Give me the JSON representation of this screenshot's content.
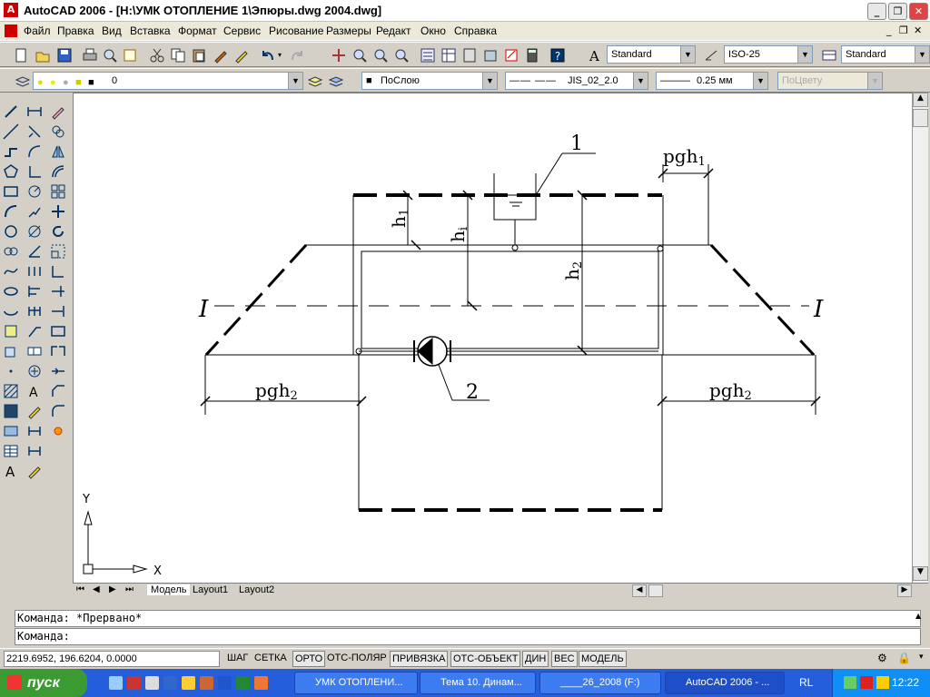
{
  "window": {
    "title": "AutoCAD 2006 - [H:\\УМК ОТОПЛЕНИЕ 1\\Эпюры.dwg 2004.dwg]"
  },
  "menu": [
    "Файл",
    "Правка",
    "Вид",
    "Вставка",
    "Формат",
    "Сервис",
    "Рисование",
    "Размеры",
    "Редакт",
    "Окно",
    "Справка"
  ],
  "toolbar": {
    "text_style": "Standard",
    "dim_style": "ISO-25",
    "table_style": "Standard",
    "layer": "0",
    "color": "ПоСлою",
    "linetype": "JIS_02_2.0",
    "lineweight": "0.25 мм",
    "plot_style": "ПоЦвету"
  },
  "drawing": {
    "labels": {
      "callout1": "1",
      "callout2": "2",
      "pgh1": "pgh",
      "pgh1_sub": "1",
      "pgh2_left": "pgh",
      "pgh2_left_sub": "2",
      "pgh2_right": "pgh",
      "pgh2_right_sub": "2",
      "h1": "h",
      "h1_sub": "1",
      "hi": "h",
      "hi_sub": "i",
      "h2": "h",
      "h2_sub": "2",
      "section_left": "I",
      "section_right": "I",
      "axis_y": "Y",
      "axis_x": "X"
    }
  },
  "tabs": [
    "Модель",
    "Layout1",
    "Layout2"
  ],
  "command": {
    "history": "Команда: *Прервано*",
    "prompt": "Команда:"
  },
  "status": {
    "coords": "2219.6952, 196.6204, 0.0000",
    "buttons": [
      "ШАГ",
      "СЕТКА",
      "ОРТО",
      "ОТС-ПОЛЯР",
      "ПРИВЯЗКА",
      "ОТС-ОБЪЕКТ",
      "ДИН",
      "ВЕС",
      "МОДЕЛЬ"
    ]
  },
  "taskbar": {
    "start": "пуск",
    "tasks": [
      "УМК ОТОПЛЕНИ...",
      "Тема 10. Динам...",
      "____26_2008 (F:)",
      "AutoCAD 2006 - ..."
    ],
    "lang": "RL",
    "clock": "12:22"
  }
}
